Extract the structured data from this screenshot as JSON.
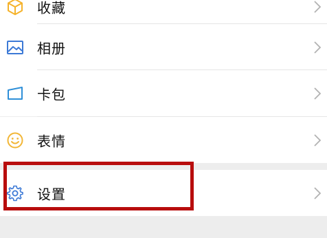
{
  "menu": {
    "items": [
      {
        "label": "收藏",
        "icon": "favorites-cube-icon"
      },
      {
        "label": "相册",
        "icon": "album-picture-icon"
      },
      {
        "label": "卡包",
        "icon": "card-wallet-icon"
      },
      {
        "label": "表情",
        "icon": "sticker-smiley-icon"
      },
      {
        "label": "设置",
        "icon": "settings-gear-icon"
      }
    ],
    "chevron_icon": "chevron-right-icon"
  },
  "colors": {
    "background": "#ededed",
    "row": "#ffffff",
    "favorites_icon": "#f5b22a",
    "album_icon": "#3c79d6",
    "card_icon": "#2e8fd8",
    "sticker_icon": "#f2b636",
    "settings_icon": "#3c79d6",
    "highlight_box": "#b80d0d"
  }
}
